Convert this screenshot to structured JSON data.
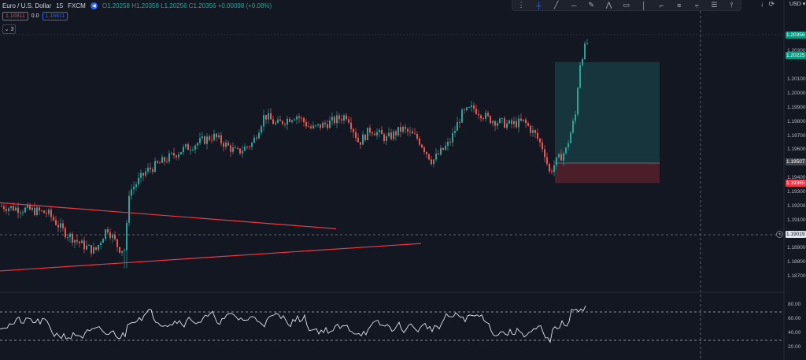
{
  "header": {
    "symbol": "Euro / U.S. Dollar",
    "interval": "15",
    "exchange": "FXCM",
    "ohlc": {
      "o_label": "O",
      "o": "1.20258",
      "h_label": "H",
      "h": "1.20358",
      "l_label": "L",
      "l": "1.20256",
      "c_label": "C",
      "c": "1.20356",
      "change": "+0.00098 (+0.08%)"
    },
    "sell_price": "1.16811",
    "spread": "0.0",
    "buy_price": "1.16811",
    "collapse_count": "3"
  },
  "toolbar": {
    "icons": [
      "drag-handle-icon",
      "crosshair-icon",
      "trend-line-icon",
      "horizontal-line-icon",
      "brush-icon",
      "pattern-icon",
      "measure-icon",
      "vertical-line-icon",
      "callout-icon",
      "text-icon",
      "fib-icon",
      "ruler-icon",
      "pin-icon"
    ]
  },
  "top_right": {
    "currency": "USD"
  },
  "price_axis": {
    "ticks": [
      "1.20400",
      "1.20300",
      "1.20100",
      "1.20000",
      "1.19900",
      "1.19800",
      "1.19700",
      "1.19600",
      "1.19400",
      "1.19300",
      "1.19200",
      "1.19100",
      "1.18900",
      "1.18800",
      "1.18700"
    ],
    "tags": {
      "current": "1.20356",
      "target": "1.20225",
      "entry": "1.19507",
      "stop": "1.19365",
      "crosshair": "1.19019"
    }
  },
  "indicator_axis": {
    "ticks": [
      "80.00",
      "60.00",
      "40.00",
      "20.00"
    ]
  },
  "colors": {
    "background": "#131722",
    "bull": "#26a69a",
    "bear": "#ef5350",
    "trendline": "#f23645",
    "profit_zone": "#26a69a",
    "loss_zone": "#f23645"
  },
  "chart_data": {
    "type": "candlestick",
    "ylim": [
      1.1865,
      1.2042
    ],
    "trend_lines": [
      {
        "from": [
          0,
          1.19225
        ],
        "to": [
          427,
          1.1904
        ]
      },
      {
        "from": [
          0,
          1.1874
        ],
        "to": [
          535,
          1.18935
        ]
      }
    ],
    "position": {
      "type": "long",
      "target": 1.20225,
      "entry": 1.19507,
      "stop": 1.19365
    },
    "rsi": {
      "ylim": [
        10,
        90
      ],
      "levels": [
        70,
        30
      ]
    }
  }
}
